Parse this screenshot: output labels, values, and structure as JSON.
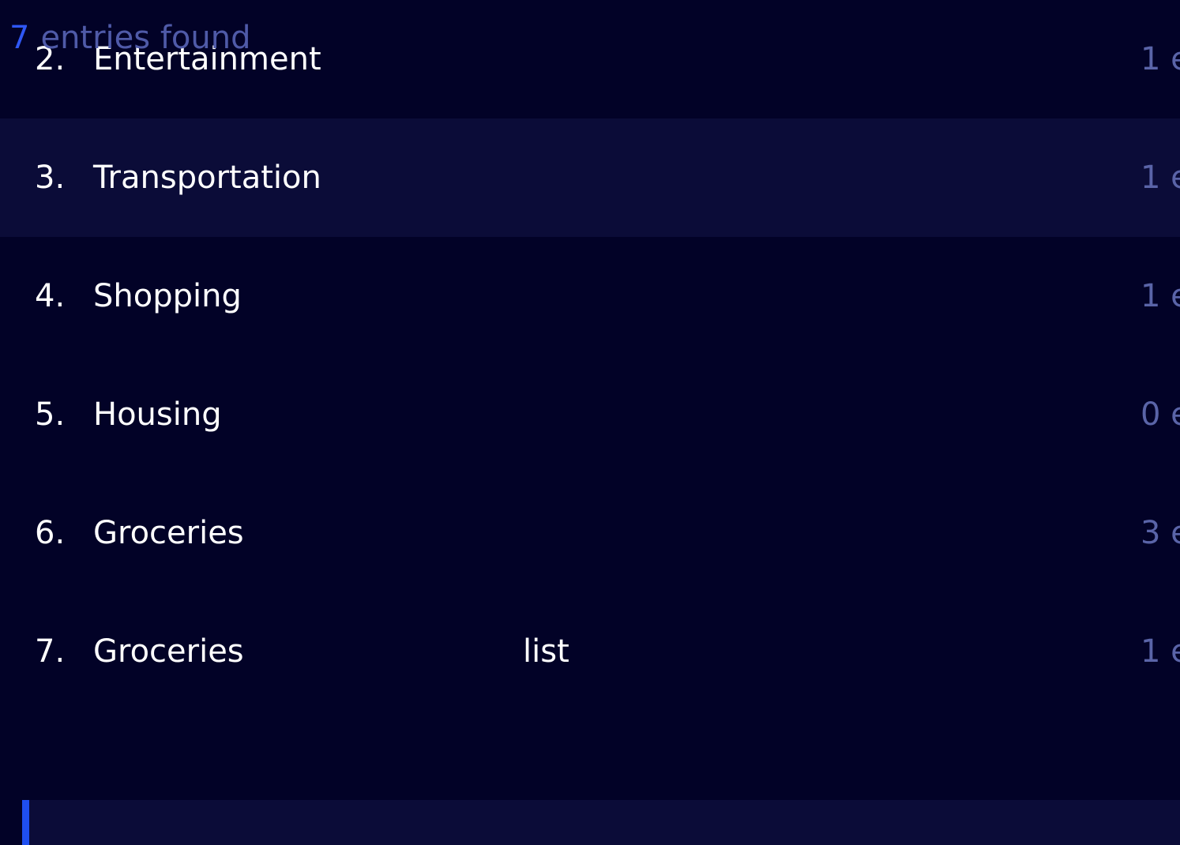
{
  "results": {
    "count": "7",
    "label": "entries found"
  },
  "categories": [
    {
      "number": "2.",
      "name": "Entertainment",
      "extra": "",
      "meta": "1 e"
    },
    {
      "number": "3.",
      "name": "Transportation",
      "extra": "",
      "meta": "1 e"
    },
    {
      "number": "4.",
      "name": "Shopping",
      "extra": "",
      "meta": "1 e"
    },
    {
      "number": "5.",
      "name": "Housing",
      "extra": "",
      "meta": "0 e"
    },
    {
      "number": "6.",
      "name": "Groceries",
      "extra": "",
      "meta": "3 e"
    },
    {
      "number": "7.",
      "name": "Groceries",
      "extra": "list",
      "meta": "1 e"
    }
  ],
  "colors": {
    "background": "#020227",
    "row_highlight": "#0b0c38",
    "accent": "#2f57f5",
    "muted_text": "#5a64a8"
  }
}
